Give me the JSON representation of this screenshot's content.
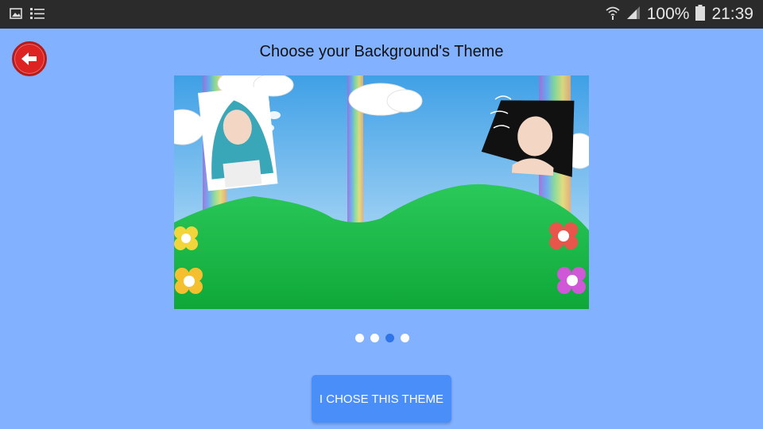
{
  "status_bar": {
    "battery_percent": "100%",
    "time": "21:39",
    "icons": [
      "image-icon",
      "list-icon",
      "wifi-icon",
      "signal-icon",
      "battery-icon"
    ]
  },
  "header": {
    "back_icon": "back-arrow-icon",
    "title": "Choose your Background's Theme"
  },
  "carousel": {
    "page_count": 4,
    "active_index": 2
  },
  "action": {
    "label": "I CHOSE THIS THEME"
  },
  "colors": {
    "background": "#82b1ff",
    "status_bar": "#2b2b2b",
    "button": "#4a8ef9",
    "back_button": "#d22222",
    "active_dot": "#2f74e8",
    "hill": "#1fbf45"
  }
}
